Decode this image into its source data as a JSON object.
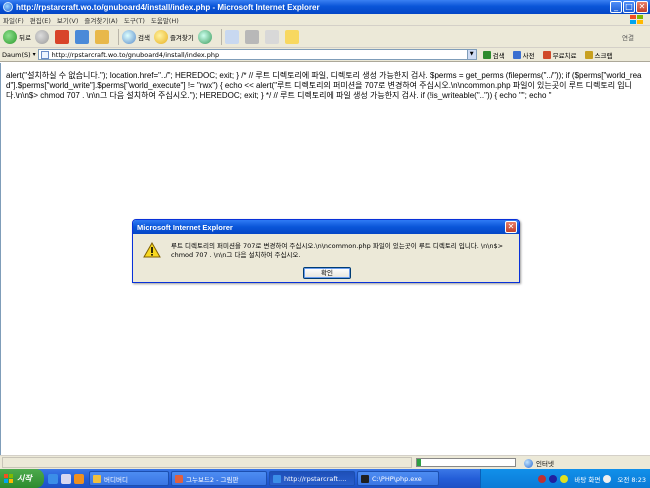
{
  "window": {
    "title": "http://rpstarcraft.wo.to/gnuboard4/install/index.php - Microsoft Internet Explorer"
  },
  "menu": {
    "items": [
      "파일(F)",
      "편집(E)",
      "보기(V)",
      "즐겨찾기(A)",
      "도구(T)",
      "도움말(H)"
    ]
  },
  "toolbar": {
    "back_label": "뒤로",
    "search_label": "검색",
    "favorites_label": "즐겨찾기",
    "right_label": "연결"
  },
  "address": {
    "label": "Daum(S)",
    "url": "http://rpstarcraft.wo.to/gnuboard4/install/index.php",
    "links": [
      {
        "label": "검색",
        "color": "#2e8b2e"
      },
      {
        "label": "사전",
        "color": "#3b6fd0"
      },
      {
        "label": "무료치료",
        "color": "#d04a2a"
      },
      {
        "label": "스크랩",
        "color": "#c8a020"
      }
    ]
  },
  "content": {
    "text": "alert(\"설치하실 수 없습니다.\"); location.href=\"../\"; HEREDOC; exit; } /* // 루트 디렉토리에 파일, 디렉토리 생성 가능한지 검사. $perms = get_perms (fileperms(\"../\")); if ($perms[\"world_read\"].$perms[\"world_write\"].$perms[\"world_execute\"] != \"rwx\") { echo << alert(\"루트 디렉토리의 퍼미션을 707로 변경하여 주십시오.\\n\\ncommon.php 파일이 있는곳이 루트 디렉토리 입니다.\\n\\n$> chmod 707 . \\n\\n그 다음 설치하여 주십시오.\"); HEREDOC; exit; } */ // 루트 디렉토리에 파일 생성 가능한지 검사. if (!is_writeable(\"..\")) { echo \"\"; echo \""
  },
  "dialog": {
    "title": "Microsoft Internet Explorer",
    "message": "루트 디렉토리의 퍼미션을 707로 변경하여 주십시오.\\n\\ncommon.php 파일이 있는곳이 루트 디렉토리 입니다. \\n\\n$> chmod 707 . \\n\\n그 다음 설치하여 주십시오.",
    "ok_label": "확인"
  },
  "statusbar": {
    "zone": "인터넷",
    "progress": 0.04
  },
  "taskbar": {
    "start_label": "시작",
    "tasks": [
      {
        "label": "버디버디",
        "color": "#f0c040"
      },
      {
        "label": "그누보드2 - 그림판",
        "color": "#e06040"
      },
      {
        "label": "http://rpstarcraft....",
        "color": "#3b8ee8"
      },
      {
        "label": "C:\\PHP\\php.exe",
        "color": "#202020"
      }
    ],
    "tray_text": "바탕 화면",
    "clock": "오전 8:23"
  }
}
